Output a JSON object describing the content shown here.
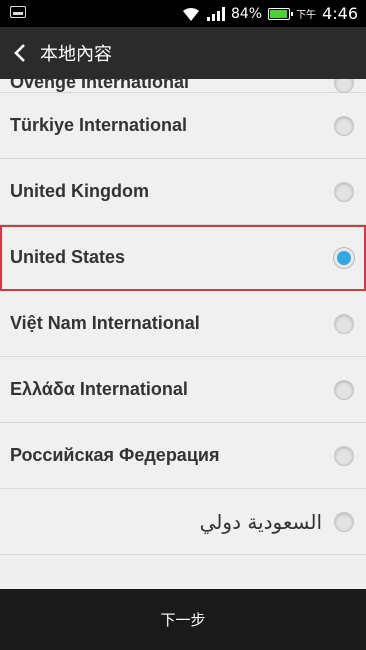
{
  "status_bar": {
    "battery_percent": "84%",
    "ampm": "下午",
    "time": "4:46",
    "battery_color": "#4cd133"
  },
  "header": {
    "title": "本地內容"
  },
  "list": {
    "partial_item": "Ovenge International",
    "items": [
      {
        "label": "Türkiye International",
        "selected": false
      },
      {
        "label": "United Kingdom",
        "selected": false
      },
      {
        "label": "United States",
        "selected": true
      },
      {
        "label": "Việt Nam International",
        "selected": false
      },
      {
        "label": "Ελλάδα International",
        "selected": false
      },
      {
        "label": "Российская Федерация",
        "selected": false
      },
      {
        "label": "السعودية دولي",
        "selected": false
      }
    ]
  },
  "footer": {
    "next_label": "下一步"
  },
  "colors": {
    "accent": "#31a7e4",
    "highlight": "#d8373b"
  }
}
